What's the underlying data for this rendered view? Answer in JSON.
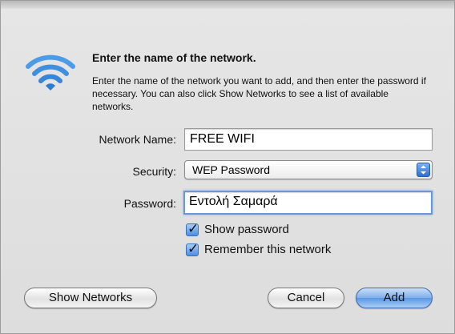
{
  "dialog": {
    "heading": "Enter the name of the network.",
    "description": "Enter the name of the network you want to add, and then enter the password if necessary. You can also click Show Networks to see a list of available networks.",
    "icon": "wifi-icon"
  },
  "form": {
    "network_name_label": "Network Name:",
    "network_name_value": "FREE WIFI",
    "security_label": "Security:",
    "security_value": "WEP Password",
    "password_label": "Password:",
    "password_value": "Εντολή Σαμαρά",
    "show_password_label": "Show password",
    "show_password_checked": true,
    "remember_label": "Remember this network",
    "remember_checked": true
  },
  "buttons": {
    "show_networks": "Show Networks",
    "cancel": "Cancel",
    "add": "Add"
  },
  "colors": {
    "accent": "#5a97e4",
    "wifi_icon": "#3f8fe0"
  }
}
